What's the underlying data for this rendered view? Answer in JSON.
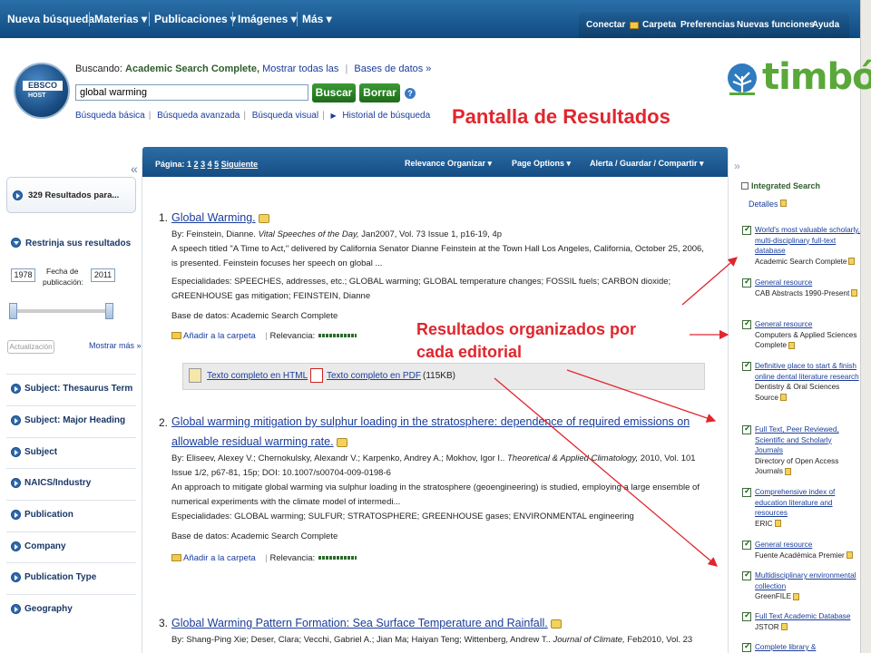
{
  "topnav": {
    "items": [
      "Nueva búsqueda",
      "Materias ▾",
      "Publicaciones ▾",
      "Imágenes ▾",
      "Más ▾"
    ],
    "toolbar": [
      "Conectar",
      "Carpeta",
      "Preferencias",
      "Nuevas funciones",
      "Ayuda"
    ]
  },
  "header": {
    "logo_top": "EBSCO",
    "logo_bottom": "HOST",
    "searching_label": "Buscando:",
    "database": "Academic Search Complete,",
    "show_all": "Mostrar todas las",
    "databases_link": "Bases de datos »",
    "query": "global warming",
    "search_btn": "Buscar",
    "clear_btn": "Borrar",
    "help": "?",
    "links": [
      "Búsqueda básica",
      "Búsqueda avanzada",
      "Búsqueda visual",
      "Historial de búsqueda"
    ],
    "timbo": "timbó",
    "slide_title": "Pantalla de Resultados"
  },
  "left": {
    "collapse": "«",
    "results": "329 Resultados para...",
    "refine": "Restrinja sus resultados",
    "date_from": "1978",
    "date_to": "2011",
    "date_label_1": "Fecha de",
    "date_label_2": "publicación:",
    "update": "Actualización",
    "show_more": "Mostrar más »",
    "facets": [
      "Subject: Thesaurus Term",
      "Subject: Major Heading",
      "Subject",
      "NAICS/Industry",
      "Publication",
      "Company",
      "Publication Type",
      "Geography"
    ]
  },
  "main": {
    "paging": "Página: 1",
    "pages": [
      "2",
      "3",
      "4",
      "5"
    ],
    "next": "Siguiente",
    "sort": "Relevance Organizar ▾",
    "page_options": "Page Options ▾",
    "alert": "Alerta / Guardar / Compartir ▾",
    "results": [
      {
        "num": "1.",
        "title": "Global Warming.",
        "by_prefix": "By: Feinstein, Dianne.",
        "source": "Vital Speeches of the Day,",
        "by_rest": "Jan2007, Vol. 73 Issue 1, p16-19, 4p",
        "abstract": "A speech titled \"A Time to Act,\" delivered by California Senator Dianne Feinstein at the Town Hall Los Angeles, California, October 25, 2006, is presented. Feinstein focuses her speech on global ...",
        "subjects": "Especialidades: SPEECHES, addresses, etc.; GLOBAL warming; GLOBAL temperature changes; FOSSIL fuels; CARBON dioxide; GREENHOUSE gas mitigation; FEINSTEIN, Dianne",
        "db": "Base de datos: Academic Search Complete",
        "add": "Añadir a la carpeta",
        "rel": "Relevancia:",
        "html": "Texto completo en HTML",
        "pdf": "Texto completo en PDF",
        "pdf_size": "(115KB)"
      },
      {
        "num": "2.",
        "title_1": "Global warming mitigation by sulphur loading in the stratosphere: dependence of required emissions on",
        "title_2": "allowable residual warming rate.",
        "by_prefix": "By: Eliseev, Alexey V.; Chernokulsky, Alexandr V.; Karpenko, Andrey A.; Mokhov, Igor I..",
        "source": "Theoretical & Applied Climatology,",
        "by_rest": "2010, Vol. 101",
        "by_line2": "Issue 1/2, p67-81, 15p; DOI: 10.1007/s00704-009-0198-6",
        "abstract": "An approach to mitigate global warming via sulphur loading in the stratosphere (geoengineering) is studied, employing a large ensemble of numerical experiments with the climate model of intermedi...",
        "subjects": "Especialidades: GLOBAL warming; SULFUR; STRATOSPHERE; GREENHOUSE gases; ENVIRONMENTAL engineering",
        "db": "Base de datos: Academic Search Complete",
        "add": "Añadir a la carpeta",
        "rel": "Relevancia:"
      },
      {
        "num": "3.",
        "title": "Global Warming Pattern Formation: Sea Surface Temperature and Rainfall.",
        "by_prefix": "By: Shang-Ping Xie; Deser, Clara; Vecchi, Gabriel A.; Jian Ma; Haiyan Teng; Wittenberg, Andrew T..",
        "source": "Journal of Climate,",
        "by_rest": "Feb2010, Vol. 23"
      }
    ]
  },
  "right": {
    "expand": "»",
    "title": "Integrated Search",
    "details": "Detalles",
    "items": [
      {
        "link": "World's most valuable scholarly, multi-disciplinary full-text database",
        "source": "Academic Search Complete"
      },
      {
        "link": "General resource",
        "source": "CAB Abstracts 1990-Present"
      },
      {
        "link": "General resource",
        "source": "Computers & Applied Sciences Complete"
      },
      {
        "link": "Definitive place to start & finish online dental literature research",
        "source": "Dentistry & Oral Sciences Source"
      },
      {
        "link": "Full Text, Peer Reviewed, Scientific and Scholarly Journals",
        "source": "Directory of Open Access Journals"
      },
      {
        "link": "Comprehensive index of education literature and resources",
        "source": "ERIC"
      },
      {
        "link": "General resource",
        "source": "Fuente Académica Premier"
      },
      {
        "link": "Multidisciplinary environmental collection",
        "source": "GreenFILE"
      },
      {
        "link": "Full Text Academic Database",
        "source": "JSTOR"
      },
      {
        "link": "Complete library &",
        "source": ""
      }
    ]
  },
  "annotation": {
    "line1": "Resultados organizados por",
    "line2": "cada editorial"
  },
  "colors": {
    "accent": "#e0262d",
    "nav": "#144d82",
    "link": "#1a3d9c",
    "brand_green": "#5aa83a"
  }
}
